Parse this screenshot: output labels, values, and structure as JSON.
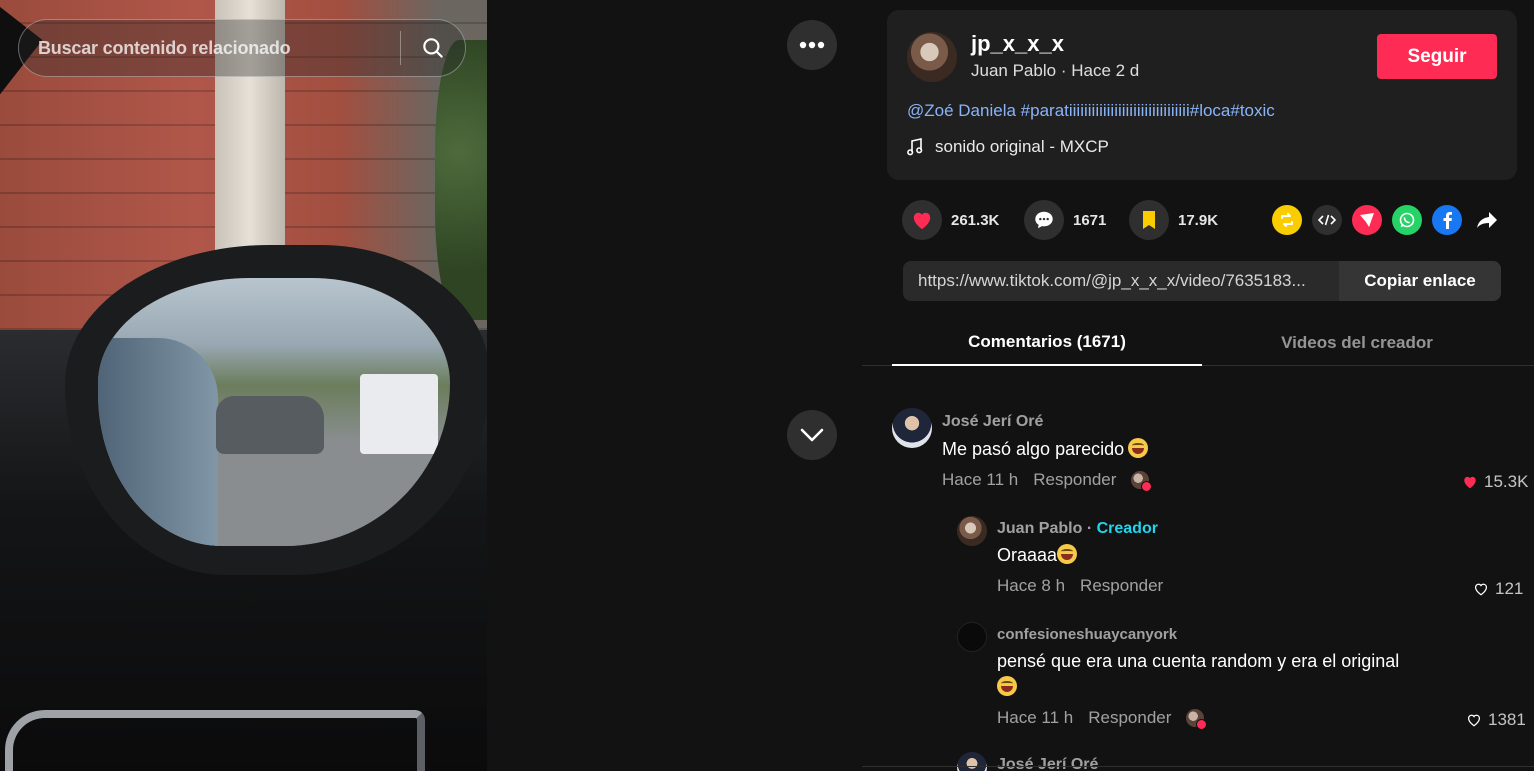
{
  "search": {
    "placeholder": "Buscar contenido relacionado",
    "icon": "search-icon"
  },
  "video_controls": {
    "more_icon": "more-dots-icon",
    "next_icon": "chevron-down-icon"
  },
  "post": {
    "username": "jp_x_x_x",
    "display_name": "Juan Pablo",
    "separator": "·",
    "time": "Hace 2 d",
    "follow_label": "Seguir",
    "caption": [
      "@Zoé Daniela",
      "#paratiiiiiiiiiiiiiiiiiiiiiiiiiiiiiiii",
      "#loca",
      "#toxic"
    ],
    "music": "sonido original - MXCP"
  },
  "stats": {
    "likes": "261.3K",
    "comments": "1671",
    "saves": "17.9K"
  },
  "share": {
    "link": "https://www.tiktok.com/@jp_x_x_x/video/7635183...",
    "copy_label": "Copiar enlace",
    "icons": [
      "repost-icon",
      "embed-icon",
      "send-icon",
      "whatsapp-icon",
      "facebook-icon",
      "share-arrow-icon"
    ]
  },
  "tabs": {
    "comments": "Comentarios (1671)",
    "creator_videos": "Videos del creador"
  },
  "comments": [
    {
      "author": "José Jerí Oré",
      "text": "Me pasó algo parecido",
      "time": "Hace 11 h",
      "reply": "Responder",
      "likes": "15.3K"
    },
    {
      "author": "Juan Pablo",
      "badge_sep": "·",
      "badge": "Creador",
      "text": "Oraaaa",
      "time": "Hace 8 h",
      "reply": "Responder",
      "likes": "121"
    },
    {
      "author": "confesioneshuaycanyork",
      "text": "pensé que era una cuenta random y era el original",
      "time": "Hace 11 h",
      "reply": "Responder",
      "likes": "1381"
    },
    {
      "author": "José Jerí Oré"
    }
  ],
  "colors": {
    "accent": "#fe2c55",
    "link": "#8ab4f8",
    "creator": "#20d5ec",
    "panel_bg": "#121212",
    "card_bg": "#1f1f1f"
  }
}
